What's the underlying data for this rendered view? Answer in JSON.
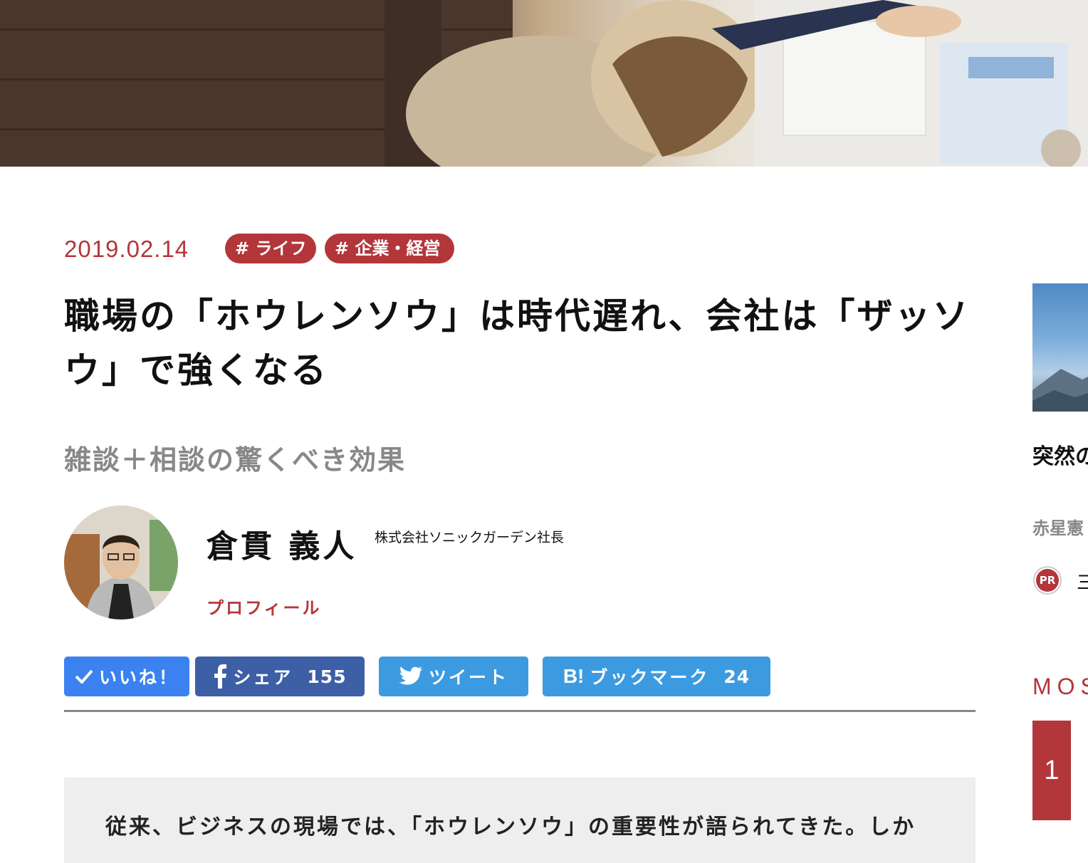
{
  "article": {
    "date": "2019.02.14",
    "tags": [
      "# ライフ",
      "# 企業・経営"
    ],
    "title": "職場の「ホウレンソウ」は時代遅れ、会社は「ザッソウ」で強くなる",
    "subtitle": "雑談＋相談の驚くべき効果",
    "lead": "従来、ビジネスの現場では、「ホウレンソウ」の重要性が語られてきた。しか"
  },
  "author": {
    "name": "倉貫 義人",
    "role": "株式会社ソニックガーデン社長",
    "profile_link": "プロフィール"
  },
  "share": {
    "like_label": "いいね！",
    "facebook_label": "シェア",
    "facebook_count": "155",
    "twitter_label": "ツイート",
    "hatena_icon": "B!",
    "hatena_label": "ブックマーク",
    "hatena_count": "24"
  },
  "sidebar": {
    "title": "突然のーが",
    "author": "赤星憲",
    "pr_badge": "PR",
    "pr_text": "三",
    "ranking_heading": "MOS",
    "rank_number": "1"
  },
  "colors": {
    "accent": "#b3363a",
    "like": "#3b82f0",
    "facebook": "#3d5fa6",
    "twitter": "#3c9be0"
  }
}
